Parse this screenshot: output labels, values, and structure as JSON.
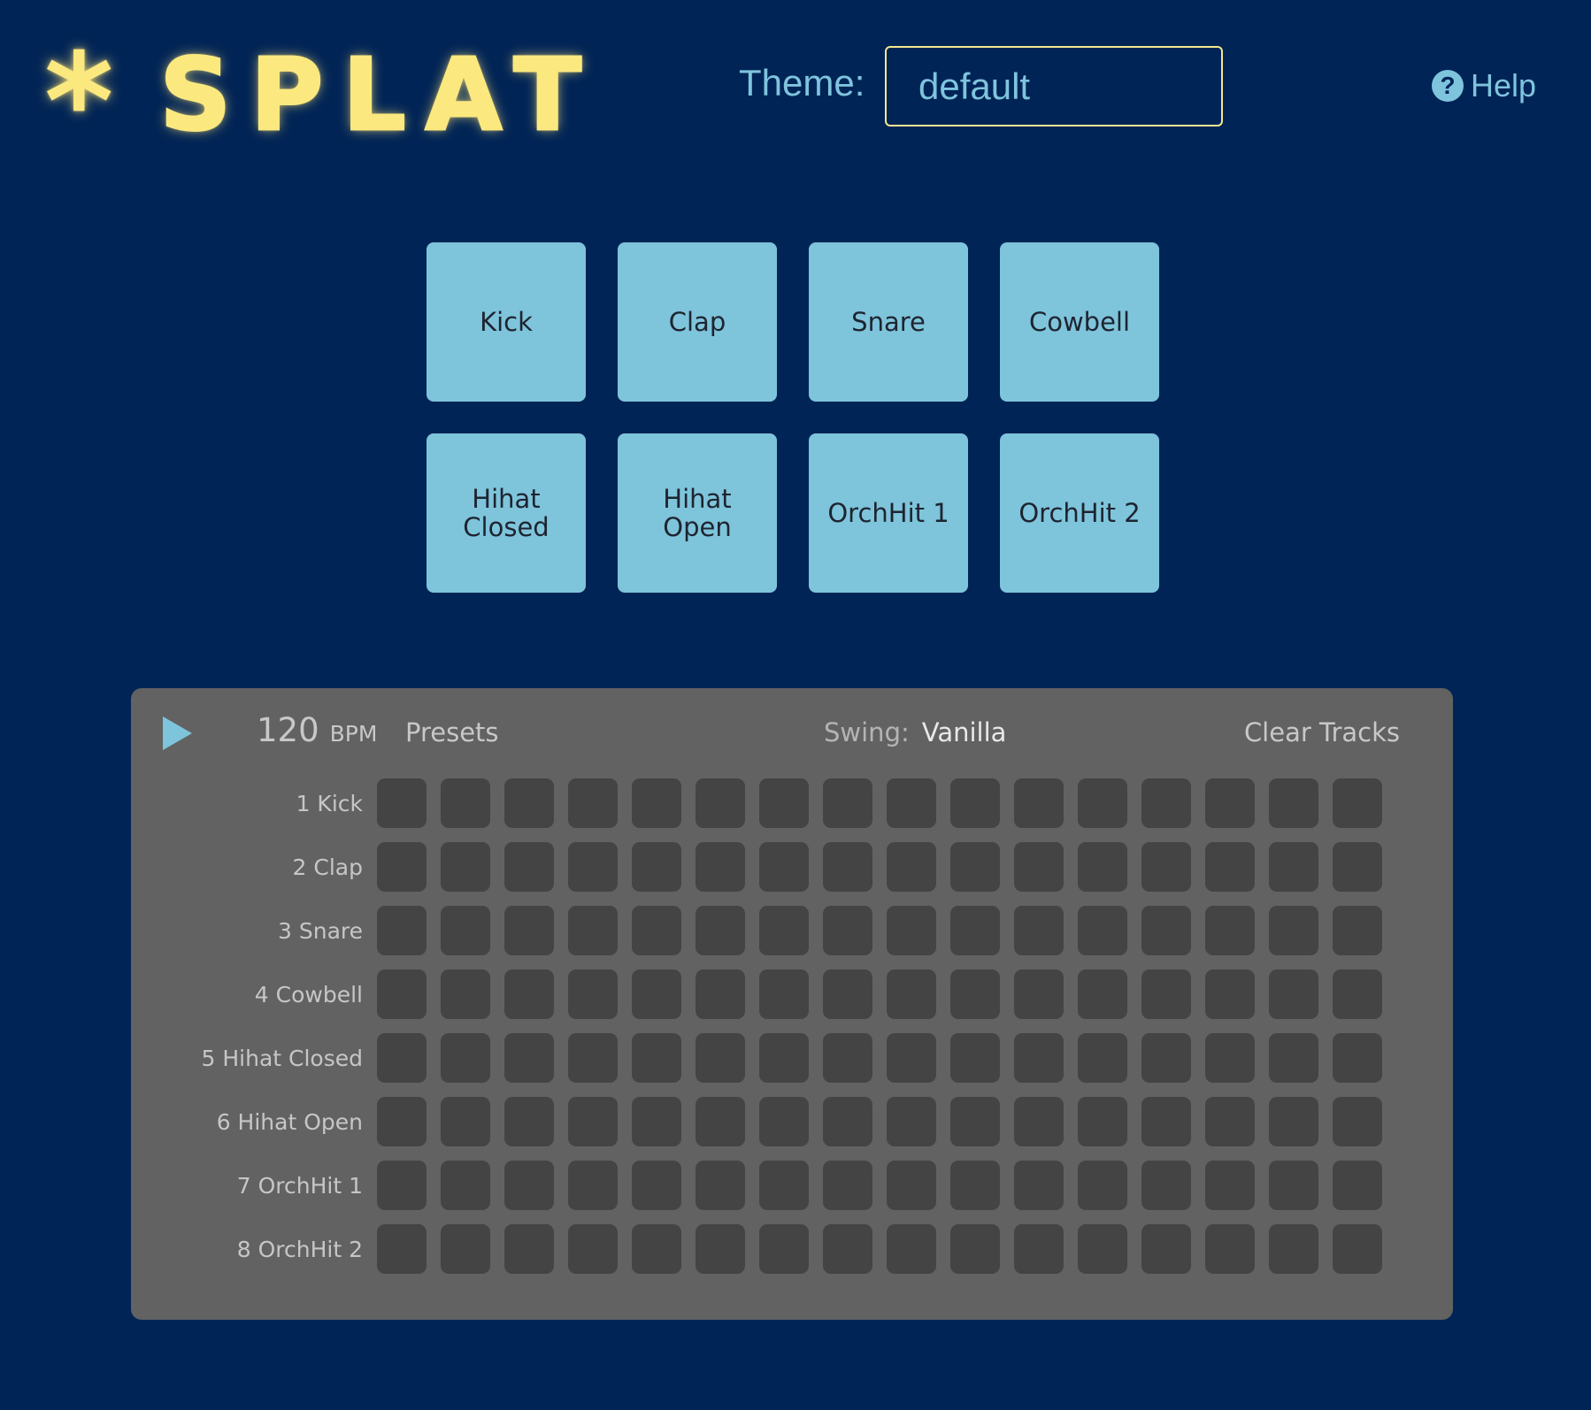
{
  "header": {
    "logo_star": "*",
    "logo_text": "SPLAT",
    "theme_label": "Theme:",
    "theme_value": "default",
    "help_icon": "?",
    "help_label": "Help"
  },
  "pads": [
    {
      "label": "Kick"
    },
    {
      "label": "Clap"
    },
    {
      "label": "Snare"
    },
    {
      "label": "Cowbell"
    },
    {
      "label": "Hihat Closed"
    },
    {
      "label": "Hihat Open"
    },
    {
      "label": "OrchHit 1"
    },
    {
      "label": "OrchHit 2"
    }
  ],
  "sequencer": {
    "play_icon": "play-icon",
    "bpm_value": "120",
    "bpm_unit": "BPM",
    "presets_label": "Presets",
    "swing_label": "Swing:",
    "swing_value": "Vanilla",
    "clear_label": "Clear Tracks",
    "steps_per_track": 16,
    "tracks": [
      {
        "label": "1 Kick"
      },
      {
        "label": "2 Clap"
      },
      {
        "label": "3 Snare"
      },
      {
        "label": "4 Cowbell"
      },
      {
        "label": "5 Hihat Closed"
      },
      {
        "label": "6 Hihat Open"
      },
      {
        "label": "7 OrchHit 1"
      },
      {
        "label": "8 OrchHit 2"
      }
    ]
  },
  "colors": {
    "background": "#012456",
    "logo": "#fbe97f",
    "accent": "#7fc4dd",
    "pad": "#7ec4db",
    "panel": "#626262",
    "step": "#444444"
  }
}
